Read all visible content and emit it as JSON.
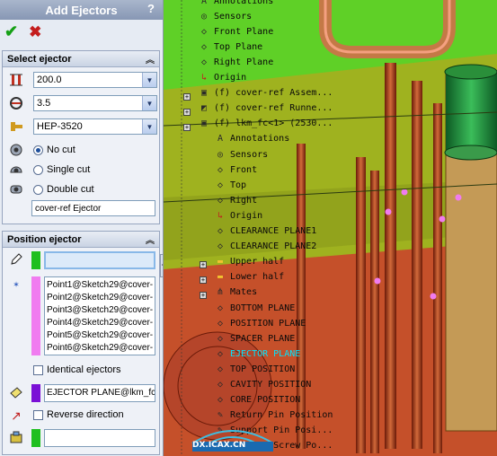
{
  "panel": {
    "title": "Add Ejectors",
    "help": "?",
    "ok_icon": "checkmark-icon",
    "cancel_icon": "x-icon"
  },
  "select_ejector": {
    "heading": "Select ejector",
    "length": "200.0",
    "diameter": "3.5",
    "type": "HEP-3520",
    "cut_options": [
      "No cut",
      "Single cut",
      "Double cut"
    ],
    "cut_selected": "No cut",
    "component_name": "cover-ref Ejector"
  },
  "position_ejector": {
    "heading": "Position ejector",
    "points": [
      "Point1@Sketch29@cover-",
      "Point2@Sketch29@cover-",
      "Point3@Sketch29@cover-",
      "Point4@Sketch29@cover-",
      "Point5@Sketch29@cover-",
      "Point6@Sketch29@cover-"
    ],
    "identical_label": "Identical ejectors",
    "identical_checked": false,
    "plane_ref": "EJECTOR PLANE@lkm_fc-",
    "reverse_label": "Reverse direction",
    "reverse_checked": false
  },
  "tree": {
    "items": [
      {
        "label": "Annotations",
        "icon": "annotation-icon"
      },
      {
        "label": "Sensors",
        "icon": "sensor-icon"
      },
      {
        "label": "Front Plane",
        "icon": "plane-icon"
      },
      {
        "label": "Top Plane",
        "icon": "plane-icon"
      },
      {
        "label": "Right Plane",
        "icon": "plane-icon"
      },
      {
        "label": "Origin",
        "icon": "origin-icon"
      },
      {
        "label": "(f) cover-ref Assem...",
        "icon": "assembly-icon"
      },
      {
        "label": "(f) cover-ref Runne...",
        "icon": "part-icon"
      },
      {
        "label": "(f) lkm_fc<1> (2530...",
        "icon": "assembly-icon"
      },
      {
        "label": "Annotations",
        "icon": "annotation-icon"
      },
      {
        "label": "Sensors",
        "icon": "sensor-icon"
      },
      {
        "label": "Front",
        "icon": "plane-icon"
      },
      {
        "label": "Top",
        "icon": "plane-icon"
      },
      {
        "label": "Right",
        "icon": "plane-icon"
      },
      {
        "label": "Origin",
        "icon": "origin-icon"
      },
      {
        "label": "CLEARANCE PLANE1",
        "icon": "plane-icon"
      },
      {
        "label": "CLEARANCE PLANE2",
        "icon": "plane-icon"
      },
      {
        "label": "Upper half",
        "icon": "folder-icon"
      },
      {
        "label": "Lower half",
        "icon": "folder-icon"
      },
      {
        "label": "Mates",
        "icon": "mates-icon"
      },
      {
        "label": "BOTTOM PLANE",
        "icon": "plane-icon"
      },
      {
        "label": "POSITION PLANE",
        "icon": "plane-icon"
      },
      {
        "label": "SPACER PLANE",
        "icon": "plane-icon"
      },
      {
        "label": "EJECTOR PLANE",
        "icon": "plane-icon"
      },
      {
        "label": "TOP POSITION",
        "icon": "plane-icon"
      },
      {
        "label": "CAVITY POSITION",
        "icon": "plane-icon"
      },
      {
        "label": "CORE POSITION",
        "icon": "plane-icon"
      },
      {
        "label": "Return Pin Position",
        "icon": "sketch-icon"
      },
      {
        "label": "Support Pin Posi...",
        "icon": "sketch-icon"
      },
      {
        "label": "Ejector Screw Po...",
        "icon": "sketch-icon"
      }
    ],
    "selected_index": 23
  },
  "watermark": "DX.ICAX.CN",
  "colors": {
    "point_list": "#f07cf0",
    "plane_swatch": "#7a10d6",
    "active_swatch": "#1fbf1f",
    "selected_tree_item": "#00e5ff"
  }
}
